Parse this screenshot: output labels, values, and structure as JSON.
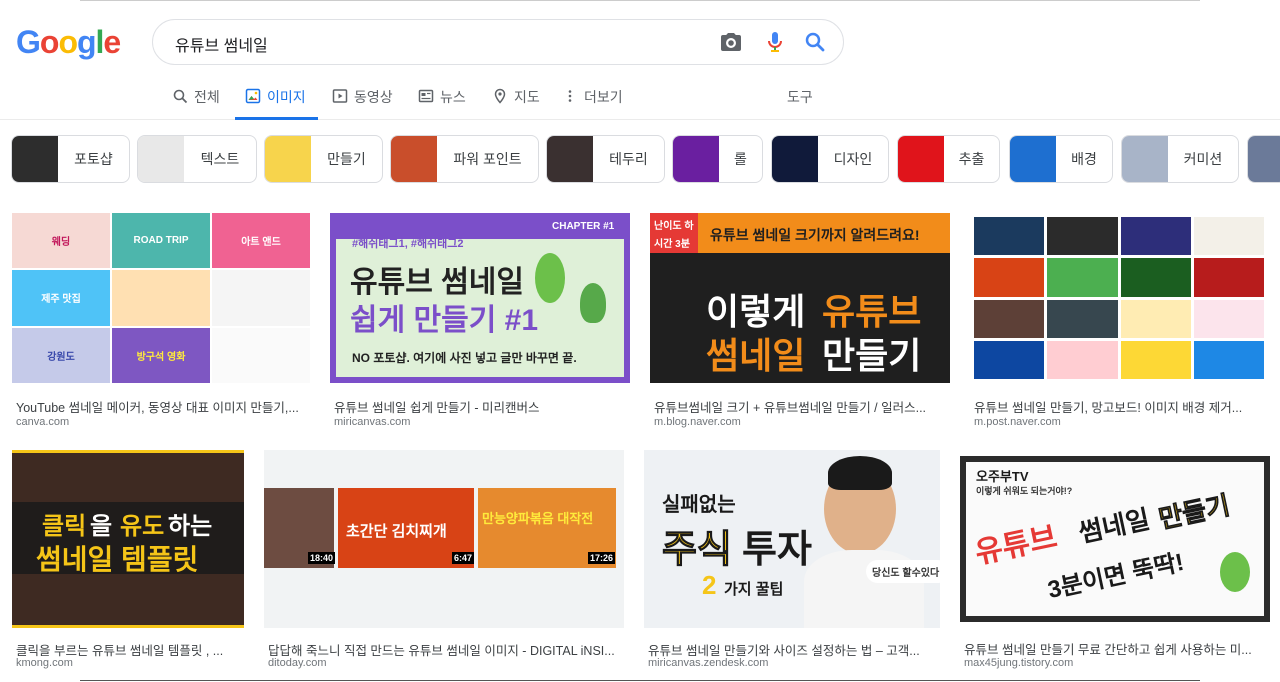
{
  "search": {
    "query": "유튜브 썸네일"
  },
  "logo": {
    "letters": [
      "G",
      "o",
      "o",
      "g",
      "l",
      "e"
    ],
    "colors": [
      "#4285f4",
      "#ea4335",
      "#fbbc05",
      "#4285f4",
      "#34a853",
      "#ea4335"
    ]
  },
  "tabs": [
    {
      "label": "전체",
      "icon": "search-icon"
    },
    {
      "label": "이미지",
      "icon": "image-icon",
      "active": true
    },
    {
      "label": "동영상",
      "icon": "video-icon"
    },
    {
      "label": "뉴스",
      "icon": "news-icon"
    },
    {
      "label": "지도",
      "icon": "map-pin-icon"
    },
    {
      "label": "더보기",
      "icon": "more-vert-icon"
    }
  ],
  "tools_label": "도구",
  "chips": [
    {
      "label": "포토샵",
      "thumb_color": "#2d2d2d"
    },
    {
      "label": "텍스트",
      "thumb_color": "#e8e8e8"
    },
    {
      "label": "만들기",
      "thumb_color": "#f7d44c"
    },
    {
      "label": "파워 포인트",
      "thumb_color": "#c94e2b"
    },
    {
      "label": "테두리",
      "thumb_color": "#3a3030"
    },
    {
      "label": "롤",
      "thumb_color": "#6a1fa0"
    },
    {
      "label": "디자인",
      "thumb_color": "#101a3a"
    },
    {
      "label": "추출",
      "thumb_color": "#e0141b"
    },
    {
      "label": "배경",
      "thumb_color": "#1e6fd0"
    },
    {
      "label": "커미션",
      "thumb_color": "#a8b4c8"
    }
  ],
  "results": [
    {
      "title": "YouTube 썸네일 메이커, 동영상 대표 이미지 만들기,...",
      "source": "canva.com"
    },
    {
      "title": "유튜브 썸네일 쉽게 만들기 - 미리캔버스",
      "source": "miricanvas.com",
      "img": {
        "tags": "#해쉬태그1, #해쉬태그2",
        "chapter": "CHAPTER #1",
        "line1": "유튜브 썸네일",
        "line2": "쉽게 만들기 #1",
        "sub": "NO 포토샵. 여기에 사진 넣고 글만 바꾸면 끝."
      }
    },
    {
      "title": "유튜브썸네일 크기 + 유튜브썸네일 만들기 / 일러스...",
      "source": "m.blog.naver.com",
      "img": {
        "level": "난이도 하",
        "time": "시간 3분",
        "banner": "유튜브 썸네일 크기까지 알려드려요!",
        "line1a": "이렇게",
        "line1b": "유튜브",
        "line2a": "썸네일",
        "line2b": "만들기"
      }
    },
    {
      "title": "유튜브 썸네일 만들기, 망고보드! 이미지 배경 제거...",
      "source": "m.post.naver.com"
    },
    {
      "title": "클릭을 부르는 유튜브 썸네일 템플릿 , ...",
      "source": "kmong.com",
      "img": {
        "line1a": "클릭",
        "line1b": "을 ",
        "line1c": "유도",
        "line1d": "하는",
        "line2": "썸네일 템플릿"
      }
    },
    {
      "title": "답답해 죽느니 직접 만드는 유튜브 썸네일 이미지 - DIGITAL iNSI...",
      "source": "ditoday.com",
      "img": {
        "t1": "18:40",
        "t2": "6:47",
        "t3": "17:26",
        "kimchi": "초간단 김치찌개",
        "yang": "만능양파볶음 대작전"
      }
    },
    {
      "title": "유튜브 썸네일 만들기와 사이즈 설정하는 법 – 고객...",
      "source": "miricanvas.zendesk.com",
      "img": {
        "top": "실패없는",
        "main1": "주식",
        "main2": "투자",
        "num": "2",
        "tip": "가지 꿀팁",
        "bubble": "당신도 할수있다!"
      }
    },
    {
      "title": "유튜브 썸네일 만들기 무료 간단하고 쉽게 사용하는 미...",
      "source": "max45jung.tistory.com",
      "img": {
        "channel": "오주부TV",
        "small": "이렇게 쉬워도 되는거야!?",
        "big1": "유튜브",
        "big2": "썸네일",
        "big3": "만들기",
        "big4": "3분이면 뚝딱!"
      }
    }
  ],
  "colors": {
    "accent": "#1a73e8",
    "text": "#202124",
    "muted": "#70757a"
  }
}
